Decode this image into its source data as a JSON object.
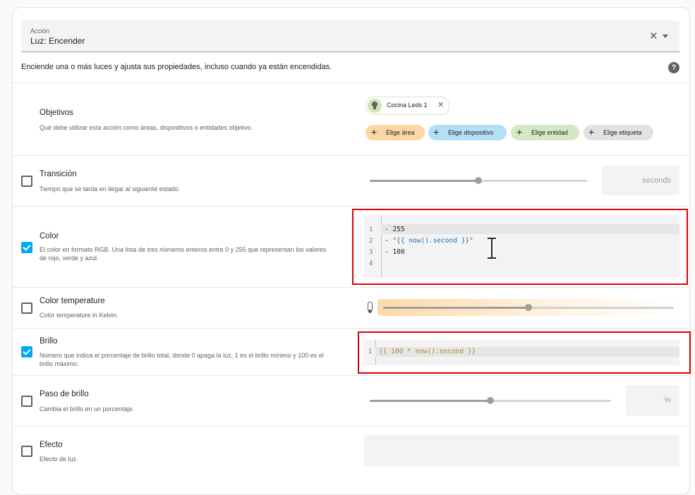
{
  "action": {
    "label": "Acción",
    "value": "Luz: Encender"
  },
  "description": "Enciende una o más luces y ajusta sus propiedades, incluso cuando ya están encendidas.",
  "targets": {
    "title": "Objetivos",
    "subtitle": "Qué debe utilizar esta acción como áreas, dispositivos o entidades objetivo.",
    "entity_chip": "Cocina Leds 1",
    "chips": [
      {
        "label": "Elige área",
        "color": "#fdd6a6"
      },
      {
        "label": "Elige dispositivo",
        "color": "#b3e0f7"
      },
      {
        "label": "Elige entidad",
        "color": "#d4e8c3"
      },
      {
        "label": "Elige etiqueta",
        "color": "#e2e2e2"
      }
    ]
  },
  "transition": {
    "title": "Transición",
    "subtitle": "Tiempo que se tarda en llegar al siguiente estado.",
    "checked": false,
    "unit": "seconds",
    "slider_fraction": 0.5
  },
  "color": {
    "title": "Color",
    "subtitle_line1": "El color en formato RGB. Una lista de tres números enteros entre 0 y 255 que representan los valores",
    "subtitle_line2": "de rojo, verde y azul.",
    "checked": true,
    "code_line_numbers": [
      "1",
      "2",
      "3",
      "4"
    ],
    "code_lines": [
      "- 255",
      "- \"{{ now().second }}\"",
      "- 100",
      ""
    ]
  },
  "color_temperature": {
    "title": "Color temperature",
    "subtitle": "Color temperature in Kelvin.",
    "checked": false,
    "slider_fraction": 0.5
  },
  "brightness": {
    "title": "Brillo",
    "subtitle_line1": "Número que indica el porcentaje de brillo total, donde 0 apaga la luz, 1 es el brillo mínimo y 100 es el",
    "subtitle_line2": "brillo máximo.",
    "checked": true,
    "code_line_numbers": [
      "1"
    ],
    "code": "{{ 100 * now().second }}"
  },
  "brightness_step": {
    "title": "Paso de brillo",
    "subtitle": "Cambia el brillo en un porcentaje.",
    "checked": false,
    "unit": "%",
    "slider_fraction": 0.5
  },
  "effect": {
    "title": "Efecto",
    "subtitle": "Efecto de luz.",
    "checked": false
  }
}
